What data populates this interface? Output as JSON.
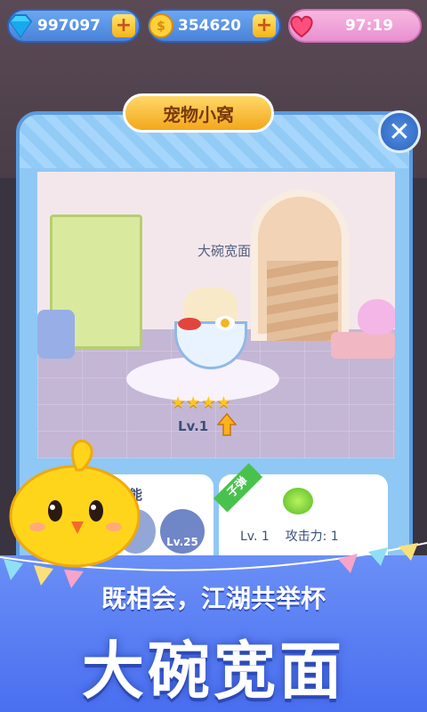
{
  "hud": {
    "diamonds": "997097",
    "coins": "354620",
    "energy": "97:19"
  },
  "panel": {
    "title": "宠物小窝",
    "pet_name": "大碗宽面",
    "stars": "★★★★",
    "pet_level": "Lv.1"
  },
  "skills": {
    "title": "技能",
    "locked_level": "Lv.25"
  },
  "bullet": {
    "badge": "子弹",
    "level": "Lv. 1",
    "attack": "攻击力: 1"
  },
  "banner": {
    "subtitle": "既相会，江湖共举杯",
    "headline": "大碗宽面"
  },
  "colors": {
    "accent_blue": "#4a82d8",
    "gold": "#f6b41c",
    "panel_blue": "#8fc8f5"
  }
}
